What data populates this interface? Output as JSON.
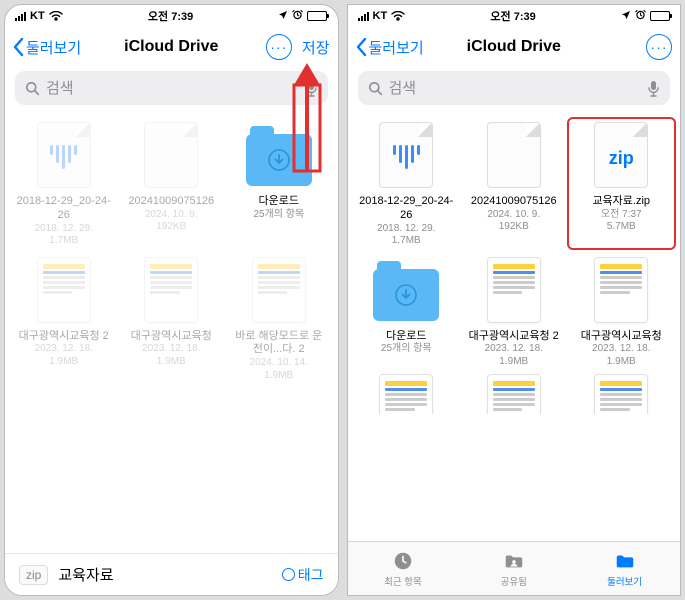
{
  "status": {
    "carrier": "KT",
    "time": "오전 7:39"
  },
  "nav": {
    "back_label": "둘러보기",
    "title": "iCloud Drive",
    "save_label": "저장"
  },
  "search": {
    "placeholder": "검색"
  },
  "left": {
    "items": [
      {
        "name": "2018-12-29_20-24-26",
        "date": "2018. 12. 29.",
        "size": "1.7MB",
        "kind": "audio"
      },
      {
        "name": "20241009075126",
        "date": "2024. 10. 9.",
        "size": "192KB",
        "kind": "file"
      },
      {
        "name": "다운로드",
        "meta": "25개의 항목",
        "kind": "folder"
      },
      {
        "name": "대구광역시교육청 2",
        "date": "2023. 12. 18.",
        "size": "1.9MB",
        "kind": "doc"
      },
      {
        "name": "대구광역시교육청",
        "date": "2023. 12. 18.",
        "size": "1.9MB",
        "kind": "doc"
      },
      {
        "name": "바로 해당모드로 운전이...다. 2",
        "date": "2024. 10. 14.",
        "size": "1.9MB",
        "kind": "doc"
      }
    ],
    "filebar": {
      "badge": "zip",
      "filename": "교육자료",
      "tag_label": "태그"
    }
  },
  "right": {
    "items": [
      {
        "name": "2018-12-29_20-24-26",
        "date": "2018. 12. 29.",
        "size": "1.7MB",
        "kind": "audio"
      },
      {
        "name": "20241009075126",
        "date": "2024. 10. 9.",
        "size": "192KB",
        "kind": "file"
      },
      {
        "name": "교육자료.zip",
        "date": "오전 7:37",
        "size": "5.7MB",
        "kind": "zip",
        "highlight": true
      },
      {
        "name": "다운로드",
        "meta": "25개의 항목",
        "kind": "folder"
      },
      {
        "name": "대구광역시교육청 2",
        "date": "2023. 12. 18.",
        "size": "1.9MB",
        "kind": "doc"
      },
      {
        "name": "대구광역시교육청",
        "date": "2023. 12. 18.",
        "size": "1.9MB",
        "kind": "doc"
      }
    ],
    "partial": [
      {
        "kind": "doc"
      },
      {
        "kind": "doc"
      },
      {
        "kind": "doc"
      }
    ]
  },
  "tabs": {
    "recent": "최근 항목",
    "shared": "공유됨",
    "browse": "둘러보기"
  },
  "colors": {
    "accent": "#007aff",
    "highlight": "#e03030"
  }
}
